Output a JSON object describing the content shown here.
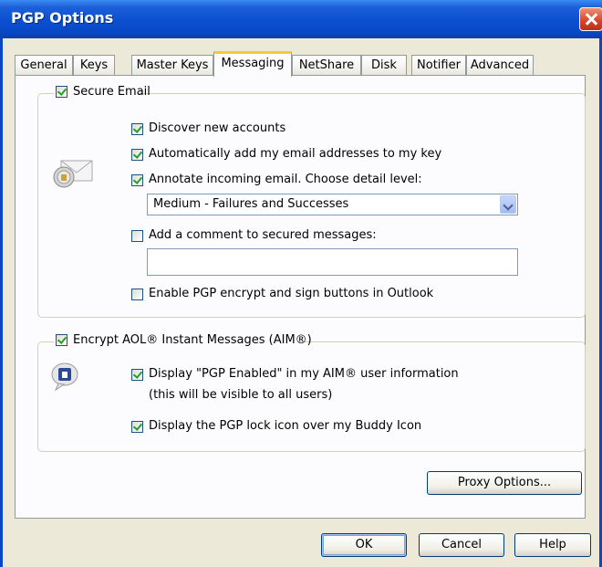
{
  "window": {
    "title": "PGP Options"
  },
  "tabs": [
    {
      "label": "General"
    },
    {
      "label": "Keys"
    },
    {
      "label": "Master Keys"
    },
    {
      "label": "Messaging"
    },
    {
      "label": "NetShare"
    },
    {
      "label": "Disk"
    },
    {
      "label": "Notifier"
    },
    {
      "label": "Advanced"
    }
  ],
  "active_tab": "Messaging",
  "secure_email": {
    "title": "Secure Email",
    "checked": true,
    "icon": "envelope-lock-icon",
    "discover": {
      "label": "Discover new accounts",
      "checked": true
    },
    "auto_add": {
      "label": "Automatically add my email addresses to my key",
      "checked": true
    },
    "annotate": {
      "label": "Annotate incoming email.  Choose detail level:",
      "checked": true
    },
    "detail_level": {
      "value": "Medium - Failures and Successes"
    },
    "comment": {
      "label": "Add a comment to secured messages:",
      "checked": false,
      "value": ""
    },
    "outlook_buttons": {
      "label": "Enable PGP encrypt and sign buttons in Outlook",
      "checked": false
    }
  },
  "aim": {
    "title": "Encrypt AOL® Instant Messages (AIM®)",
    "checked": true,
    "icon": "aim-lock-icon",
    "display_enabled": {
      "label": "Display \"PGP Enabled\" in my AIM® user information",
      "checked": true
    },
    "display_note": "(this will be visible to all users)",
    "lock_icon": {
      "label": "Display the PGP lock icon over my Buddy Icon",
      "checked": true
    }
  },
  "buttons": {
    "proxy": "Proxy Options...",
    "ok": "OK",
    "cancel": "Cancel",
    "help": "Help"
  },
  "colors": {
    "titlebar": "#0a4fd0",
    "dialog_bg": "#ece9d8",
    "panel_bg": "#fcfcfe",
    "check": "#21a121",
    "active_tab_accent": "#ffc83c"
  }
}
